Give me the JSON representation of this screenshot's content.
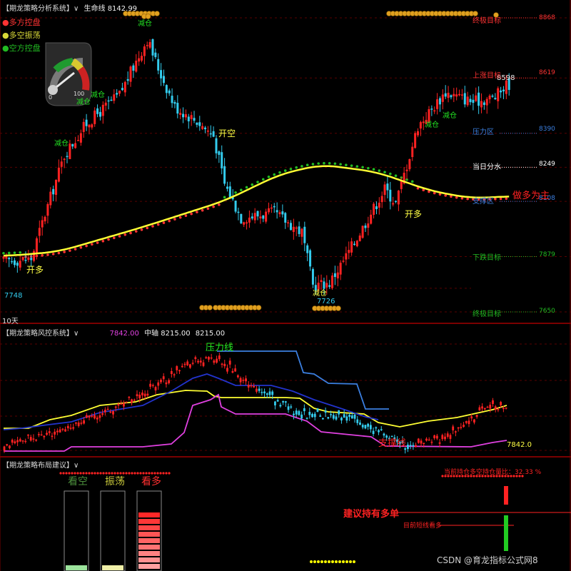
{
  "panel1": {
    "title": "【期龙策略分析系统】∨",
    "lifeline_label": "生命线 8142.99",
    "legend": [
      {
        "label": "多方控盘",
        "color": "#ff3333"
      },
      {
        "label": "多空振荡",
        "color": "#d8d838"
      },
      {
        "label": "空方控盘",
        "color": "#22bb22"
      }
    ],
    "gauge_tick_0": "0",
    "gauge_tick_100": "100",
    "period_label": "10天",
    "price_left_low": "7748",
    "price_low": "7726",
    "price_recent_high": "8598",
    "targets": [
      {
        "label": "终极目标",
        "value": "8868"
      },
      {
        "label": "上涨目标",
        "value": "8619"
      },
      {
        "label": "压力区",
        "value": "8390"
      },
      {
        "label": "当日分水",
        "value": "8249"
      },
      {
        "label": "支撑区",
        "value": "8108"
      },
      {
        "label": "下跌目标",
        "value": "7879"
      },
      {
        "label": "终极目标",
        "value": "7650"
      }
    ],
    "annotations": [
      {
        "text": "开多"
      },
      {
        "text": "减仓"
      },
      {
        "text": "减仓"
      },
      {
        "text": "减仓"
      },
      {
        "text": "减仓"
      },
      {
        "text": "开空"
      },
      {
        "text": "减仓"
      },
      {
        "text": "开多"
      },
      {
        "text": "减仓"
      },
      {
        "text": "减仓"
      },
      {
        "text": "做多为主"
      }
    ]
  },
  "panel2": {
    "title": "【期龙策略风控系统】∨",
    "value_a": "7842.00",
    "axis_label": "中轴 8215.00",
    "value_b": "8215.00",
    "pressure_label": "压力线",
    "support_label": "支撑线",
    "current_value": "7842.0"
  },
  "panel3": {
    "title": "【期龙策略布局建议】∨",
    "bars": [
      {
        "label": "看空",
        "color": "#4c8f3c"
      },
      {
        "label": "振荡",
        "color": "#c9c93a"
      },
      {
        "label": "看多",
        "color": "#ff3030"
      }
    ],
    "bar_fill": [
      0.06,
      0.06,
      0.75
    ],
    "position_text": "当前持仓多空持仓量比：32.33 %",
    "advice": "建议持有多单",
    "trend_text": "目前短线看多"
  },
  "watermark": "CSDN @育龙指标公式网8",
  "chart_data": [
    {
      "type": "candlestick",
      "title": "期龙策略分析系统",
      "series": [
        {
          "name": "生命线",
          "last": 8142.99
        },
        {
          "name": "终极目标",
          "values": [
            8868,
            7650
          ]
        },
        {
          "name": "上涨目标",
          "values": [
            8619
          ]
        },
        {
          "name": "压力区",
          "values": [
            8390
          ]
        },
        {
          "name": "当日分水",
          "values": [
            8249
          ]
        },
        {
          "name": "支撑区",
          "values": [
            8108
          ]
        },
        {
          "name": "下跌目标",
          "values": [
            7879
          ]
        }
      ],
      "y_points": {
        "low_left": 7748,
        "low": 7726,
        "recent_high": 8598
      },
      "close_anchors": [
        [
          0,
          7860
        ],
        [
          10,
          7870
        ],
        [
          14,
          8020
        ],
        [
          22,
          8300
        ],
        [
          30,
          8430
        ],
        [
          42,
          8550
        ],
        [
          52,
          8780
        ],
        [
          56,
          8660
        ],
        [
          62,
          8500
        ],
        [
          70,
          8440
        ],
        [
          76,
          8380
        ],
        [
          80,
          8180
        ],
        [
          86,
          8040
        ],
        [
          98,
          8060
        ],
        [
          108,
          7980
        ],
        [
          112,
          7760
        ],
        [
          118,
          7770
        ],
        [
          124,
          7880
        ],
        [
          132,
          8040
        ],
        [
          138,
          8160
        ],
        [
          142,
          8100
        ],
        [
          150,
          8420
        ],
        [
          160,
          8560
        ],
        [
          170,
          8520
        ],
        [
          178,
          8540
        ],
        [
          182,
          8590
        ]
      ]
    },
    {
      "type": "line",
      "title": "期龙策略风控系统",
      "series": [
        {
          "name": "压力线",
          "color": "#3b7fe0"
        },
        {
          "name": "支撑线",
          "color": "#e040e0"
        },
        {
          "name": "中轴",
          "value": 8215.0
        }
      ],
      "current": 7842.0
    },
    {
      "type": "bar",
      "title": "期龙策略布局建议",
      "categories": [
        "看空",
        "振荡",
        "看多"
      ],
      "values": [
        0.06,
        0.06,
        0.75
      ],
      "position_ratio_pct": 32.33
    }
  ]
}
